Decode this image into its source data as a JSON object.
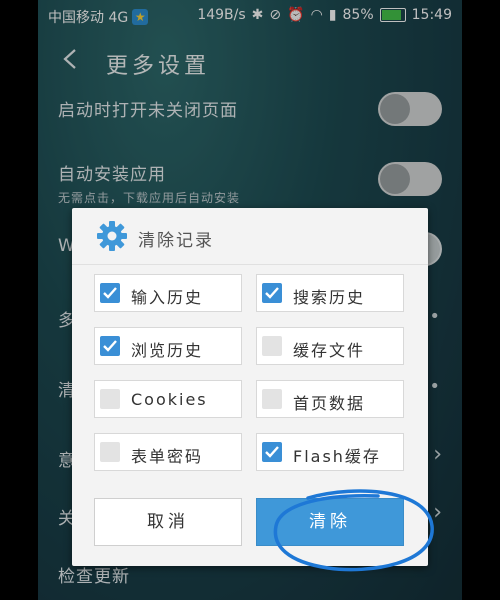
{
  "status_bar": {
    "carrier": "中国移动 4G",
    "speed": "149B/s",
    "battery": "85%",
    "time": "15:49"
  },
  "header": {
    "title": "更多设置"
  },
  "settings": [
    {
      "label": "启动时打开未关闭页面",
      "control": "toggle",
      "on": false
    },
    {
      "label": "自动安装应用",
      "sub": "无需点击，下载应用后自动安装",
      "control": "toggle",
      "on": false
    },
    {
      "label": "W",
      "control": "toggle",
      "on": true
    },
    {
      "label": "多",
      "control": "dots"
    },
    {
      "label": "清",
      "control": "dots"
    },
    {
      "label": "意",
      "control": "chevron"
    },
    {
      "label": "关",
      "control": "chevron"
    },
    {
      "label": "检查更新",
      "control": "none"
    }
  ],
  "dialog": {
    "title": "清除记录",
    "options": [
      {
        "label": "输入历史",
        "checked": true
      },
      {
        "label": "搜索历史",
        "checked": true
      },
      {
        "label": "浏览历史",
        "checked": true
      },
      {
        "label": "缓存文件",
        "checked": false
      },
      {
        "label": "Cookies",
        "checked": false
      },
      {
        "label": "首页数据",
        "checked": false
      },
      {
        "label": "表单密码",
        "checked": false
      },
      {
        "label": "Flash缓存",
        "checked": true
      }
    ],
    "cancel_label": "取消",
    "clear_label": "清除"
  },
  "colors": {
    "accent": "#3f98d9",
    "checkbox_on": "#3a8fd6",
    "annotation_circle": "#1e78d6"
  }
}
